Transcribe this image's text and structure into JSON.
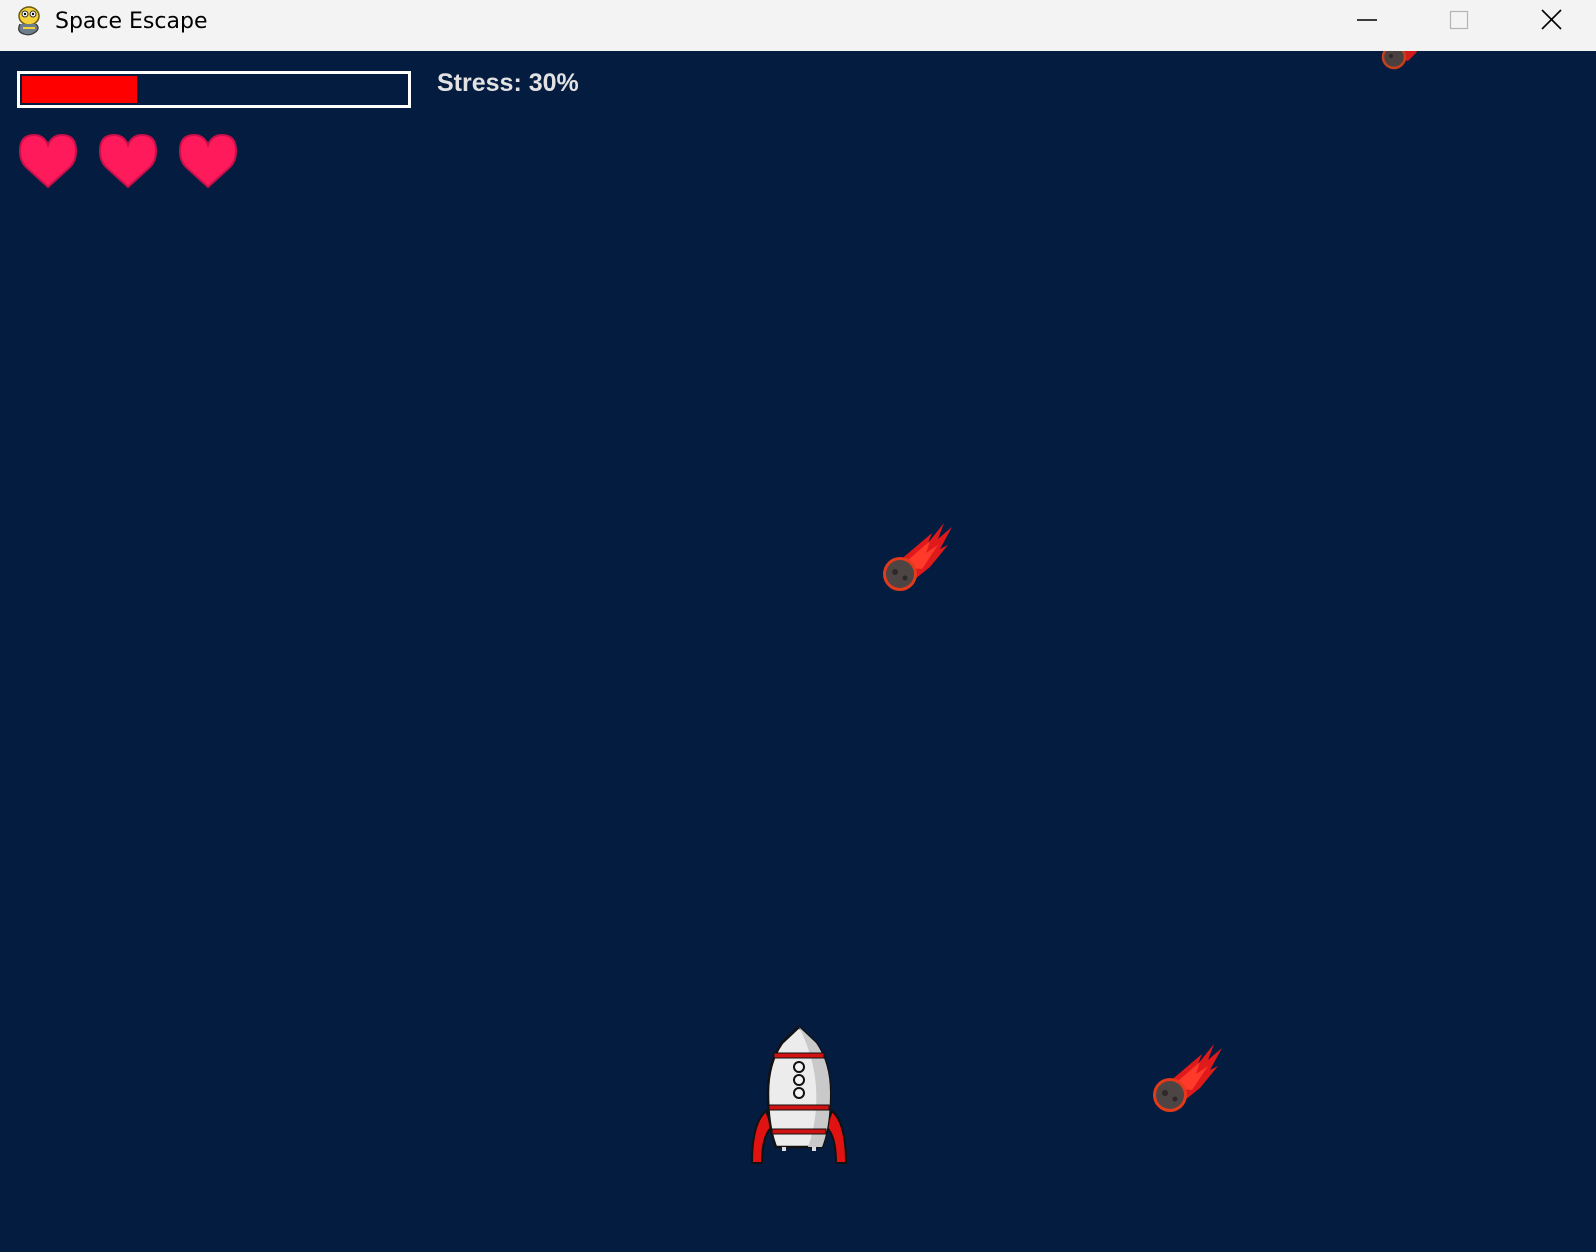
{
  "window": {
    "title": "Space Escape",
    "app_icon": "pygame-snake-icon",
    "controls": {
      "minimize_icon": "minimize-icon",
      "maximize_icon": "maximize-icon",
      "close_icon": "close-icon"
    }
  },
  "hud": {
    "stress_text": "Stress: 30%",
    "stress_fraction": 0.3,
    "stress_color": "#ff0000",
    "lives": 3,
    "heart_color": "#ff1a5c",
    "heart_icon": "heart-icon"
  },
  "scene": {
    "background_color": "#041c40",
    "player_sprite": "rocket-icon",
    "meteor_sprite": "flaming-meteor-icon",
    "meteor_count_visible": 3
  }
}
